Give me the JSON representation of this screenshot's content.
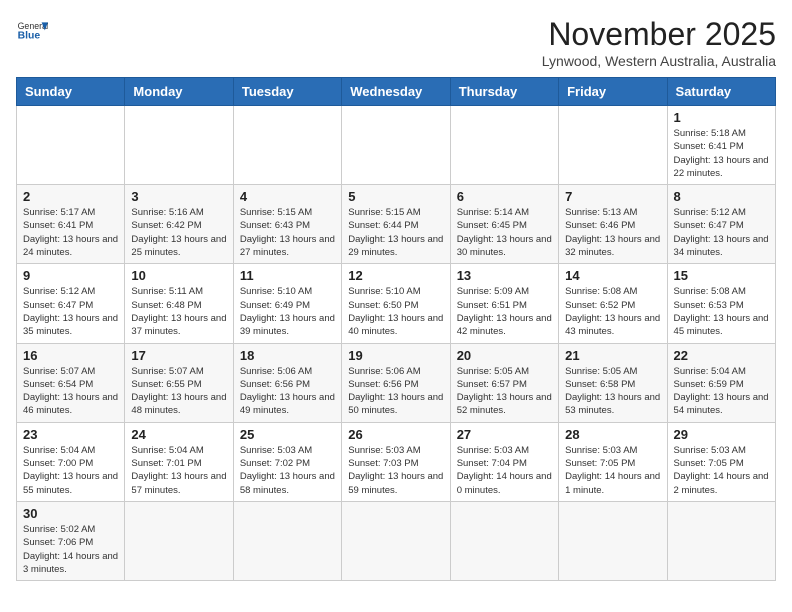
{
  "header": {
    "logo_general": "General",
    "logo_blue": "Blue",
    "title": "November 2025",
    "location": "Lynwood, Western Australia, Australia"
  },
  "days_of_week": [
    "Sunday",
    "Monday",
    "Tuesday",
    "Wednesday",
    "Thursday",
    "Friday",
    "Saturday"
  ],
  "weeks": [
    {
      "days": [
        {
          "num": "",
          "info": ""
        },
        {
          "num": "",
          "info": ""
        },
        {
          "num": "",
          "info": ""
        },
        {
          "num": "",
          "info": ""
        },
        {
          "num": "",
          "info": ""
        },
        {
          "num": "",
          "info": ""
        },
        {
          "num": "1",
          "info": "Sunrise: 5:18 AM\nSunset: 6:41 PM\nDaylight: 13 hours\nand 22 minutes."
        }
      ]
    },
    {
      "days": [
        {
          "num": "2",
          "info": "Sunrise: 5:17 AM\nSunset: 6:41 PM\nDaylight: 13 hours\nand 24 minutes."
        },
        {
          "num": "3",
          "info": "Sunrise: 5:16 AM\nSunset: 6:42 PM\nDaylight: 13 hours\nand 25 minutes."
        },
        {
          "num": "4",
          "info": "Sunrise: 5:15 AM\nSunset: 6:43 PM\nDaylight: 13 hours\nand 27 minutes."
        },
        {
          "num": "5",
          "info": "Sunrise: 5:15 AM\nSunset: 6:44 PM\nDaylight: 13 hours\nand 29 minutes."
        },
        {
          "num": "6",
          "info": "Sunrise: 5:14 AM\nSunset: 6:45 PM\nDaylight: 13 hours\nand 30 minutes."
        },
        {
          "num": "7",
          "info": "Sunrise: 5:13 AM\nSunset: 6:46 PM\nDaylight: 13 hours\nand 32 minutes."
        },
        {
          "num": "8",
          "info": "Sunrise: 5:12 AM\nSunset: 6:47 PM\nDaylight: 13 hours\nand 34 minutes."
        }
      ]
    },
    {
      "days": [
        {
          "num": "9",
          "info": "Sunrise: 5:12 AM\nSunset: 6:47 PM\nDaylight: 13 hours\nand 35 minutes."
        },
        {
          "num": "10",
          "info": "Sunrise: 5:11 AM\nSunset: 6:48 PM\nDaylight: 13 hours\nand 37 minutes."
        },
        {
          "num": "11",
          "info": "Sunrise: 5:10 AM\nSunset: 6:49 PM\nDaylight: 13 hours\nand 39 minutes."
        },
        {
          "num": "12",
          "info": "Sunrise: 5:10 AM\nSunset: 6:50 PM\nDaylight: 13 hours\nand 40 minutes."
        },
        {
          "num": "13",
          "info": "Sunrise: 5:09 AM\nSunset: 6:51 PM\nDaylight: 13 hours\nand 42 minutes."
        },
        {
          "num": "14",
          "info": "Sunrise: 5:08 AM\nSunset: 6:52 PM\nDaylight: 13 hours\nand 43 minutes."
        },
        {
          "num": "15",
          "info": "Sunrise: 5:08 AM\nSunset: 6:53 PM\nDaylight: 13 hours\nand 45 minutes."
        }
      ]
    },
    {
      "days": [
        {
          "num": "16",
          "info": "Sunrise: 5:07 AM\nSunset: 6:54 PM\nDaylight: 13 hours\nand 46 minutes."
        },
        {
          "num": "17",
          "info": "Sunrise: 5:07 AM\nSunset: 6:55 PM\nDaylight: 13 hours\nand 48 minutes."
        },
        {
          "num": "18",
          "info": "Sunrise: 5:06 AM\nSunset: 6:56 PM\nDaylight: 13 hours\nand 49 minutes."
        },
        {
          "num": "19",
          "info": "Sunrise: 5:06 AM\nSunset: 6:56 PM\nDaylight: 13 hours\nand 50 minutes."
        },
        {
          "num": "20",
          "info": "Sunrise: 5:05 AM\nSunset: 6:57 PM\nDaylight: 13 hours\nand 52 minutes."
        },
        {
          "num": "21",
          "info": "Sunrise: 5:05 AM\nSunset: 6:58 PM\nDaylight: 13 hours\nand 53 minutes."
        },
        {
          "num": "22",
          "info": "Sunrise: 5:04 AM\nSunset: 6:59 PM\nDaylight: 13 hours\nand 54 minutes."
        }
      ]
    },
    {
      "days": [
        {
          "num": "23",
          "info": "Sunrise: 5:04 AM\nSunset: 7:00 PM\nDaylight: 13 hours\nand 55 minutes."
        },
        {
          "num": "24",
          "info": "Sunrise: 5:04 AM\nSunset: 7:01 PM\nDaylight: 13 hours\nand 57 minutes."
        },
        {
          "num": "25",
          "info": "Sunrise: 5:03 AM\nSunset: 7:02 PM\nDaylight: 13 hours\nand 58 minutes."
        },
        {
          "num": "26",
          "info": "Sunrise: 5:03 AM\nSunset: 7:03 PM\nDaylight: 13 hours\nand 59 minutes."
        },
        {
          "num": "27",
          "info": "Sunrise: 5:03 AM\nSunset: 7:04 PM\nDaylight: 14 hours\nand 0 minutes."
        },
        {
          "num": "28",
          "info": "Sunrise: 5:03 AM\nSunset: 7:05 PM\nDaylight: 14 hours\nand 1 minute."
        },
        {
          "num": "29",
          "info": "Sunrise: 5:03 AM\nSunset: 7:05 PM\nDaylight: 14 hours\nand 2 minutes."
        }
      ]
    },
    {
      "days": [
        {
          "num": "30",
          "info": "Sunrise: 5:02 AM\nSunset: 7:06 PM\nDaylight: 14 hours\nand 3 minutes."
        },
        {
          "num": "",
          "info": ""
        },
        {
          "num": "",
          "info": ""
        },
        {
          "num": "",
          "info": ""
        },
        {
          "num": "",
          "info": ""
        },
        {
          "num": "",
          "info": ""
        },
        {
          "num": "",
          "info": ""
        }
      ]
    }
  ]
}
